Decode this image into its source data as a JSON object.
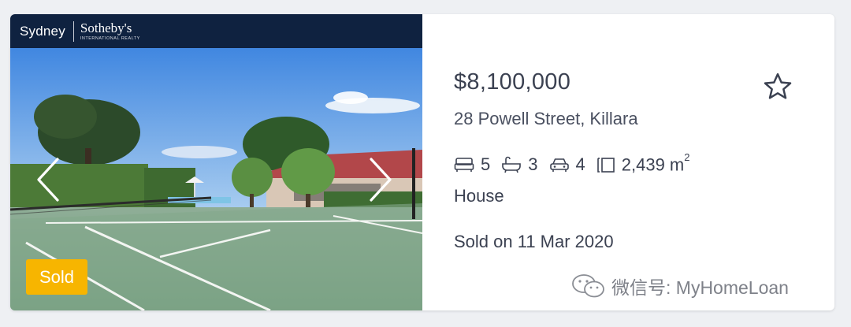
{
  "brand": {
    "city": "Sydney",
    "name": "Sotheby's",
    "subtitle": "INTERNATIONAL REALTY"
  },
  "listing": {
    "price": "$8,100,000",
    "address": "28 Powell Street, Killara",
    "bedrooms": "5",
    "bathrooms": "3",
    "car_spaces": "4",
    "land_size": "2,439 m",
    "land_unit_sup": "2",
    "property_type": "House",
    "sold_text": "Sold on 11 Mar 2020",
    "status_badge": "Sold"
  },
  "icons": {
    "prev": "chevron-left-icon",
    "next": "chevron-right-icon",
    "favorite": "star-outline-icon",
    "bed": "bed-icon",
    "bath": "bath-icon",
    "car": "car-icon",
    "land": "land-size-icon",
    "watermark": "wechat-icon"
  },
  "colors": {
    "brand_bar": "#0f2240",
    "badge": "#f7b500",
    "text": "#3b4151",
    "background": "#eef0f3"
  },
  "watermark": {
    "text": "微信号: MyHomeLoan"
  }
}
